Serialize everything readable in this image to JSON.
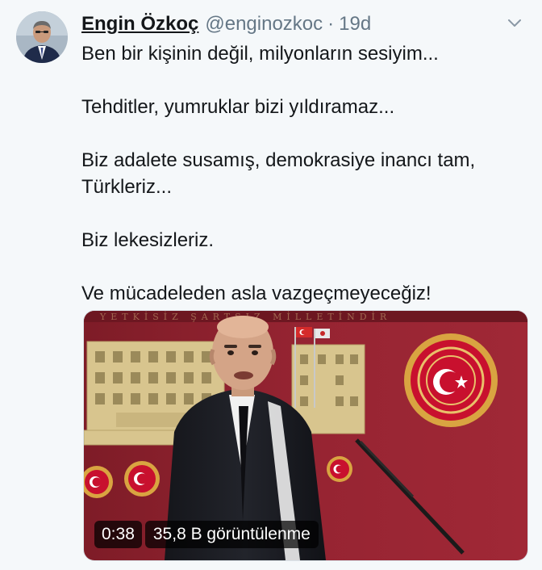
{
  "tweet": {
    "author_name": "Engin Özkoç",
    "handle": "@enginozkoc",
    "separator": "·",
    "time": "19d",
    "lines": [
      "Ben bir kişinin değil, milyonların sesiyim...",
      "Tehditler, yumruklar bizi yıldıramaz...",
      "Biz adalete susamış, demokrasiye inancı tam,",
      "Türkleriz...",
      "Biz lekesizleriz.",
      "Ve mücadeleden asla vazgeçmeyeceğiz!"
    ],
    "video": {
      "duration": "0:38",
      "views": "35,8 B görüntülenme"
    }
  },
  "icons": {
    "avatar": "profile-photo",
    "menu": "chevron-down-icon"
  },
  "colors": {
    "background": "#f5f8fa",
    "text": "#14171a",
    "secondary_text": "#657786",
    "podium_wall": "#8f1f2a",
    "emblem_red": "#c8102e",
    "emblem_gold": "#d9a441"
  }
}
